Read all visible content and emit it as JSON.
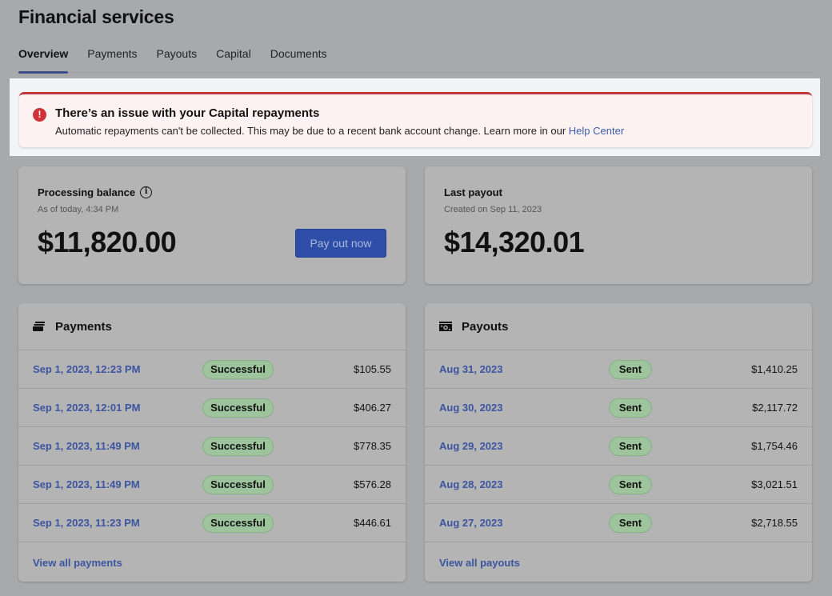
{
  "header": {
    "title": "Financial services"
  },
  "tabs": [
    {
      "label": "Overview",
      "active": true
    },
    {
      "label": "Payments",
      "active": false
    },
    {
      "label": "Payouts",
      "active": false
    },
    {
      "label": "Capital",
      "active": false
    },
    {
      "label": "Documents",
      "active": false
    }
  ],
  "alert": {
    "icon": "exclamation-circle-icon",
    "title": "There’s an issue with your Capital repayments",
    "body": "Automatic repayments can't be collected. This may be due to a recent bank account change. Learn more in our ",
    "link_label": "Help Center",
    "color": "#c0393f"
  },
  "balance": {
    "label": "Processing balance",
    "info_icon": "info-icon",
    "subtitle": "As of today, 4:34 PM",
    "amount": "$11,820.00",
    "button_label": "Pay out now"
  },
  "last_payout": {
    "label": "Last payout",
    "subtitle": "Created on Sep 11, 2023",
    "amount": "$14,320.01"
  },
  "payments": {
    "title": "Payments",
    "icon": "card-stack-icon",
    "rows": [
      {
        "date": "Sep 1, 2023, 12:23 PM",
        "status": "Successful",
        "amount": "$105.55"
      },
      {
        "date": "Sep 1, 2023, 12:01 PM",
        "status": "Successful",
        "amount": "$406.27"
      },
      {
        "date": "Sep 1, 2023, 11:49 PM",
        "status": "Successful",
        "amount": "$778.35"
      },
      {
        "date": "Sep 1, 2023, 11:49 PM",
        "status": "Successful",
        "amount": "$576.28"
      },
      {
        "date": "Sep 1, 2023, 11:23 PM",
        "status": "Successful",
        "amount": "$446.61"
      }
    ],
    "view_all_label": "View all payments"
  },
  "payouts": {
    "title": "Payouts",
    "icon": "cash-icon",
    "rows": [
      {
        "date": "Aug 31, 2023",
        "status": "Sent",
        "amount": "$1,410.25"
      },
      {
        "date": "Aug 30, 2023",
        "status": "Sent",
        "amount": "$2,117.72"
      },
      {
        "date": "Aug 29, 2023",
        "status": "Sent",
        "amount": "$1,754.46"
      },
      {
        "date": "Aug 28, 2023",
        "status": "Sent",
        "amount": "$3,021.51"
      },
      {
        "date": "Aug 27, 2023",
        "status": "Sent",
        "amount": "$2,718.55"
      }
    ],
    "view_all_label": "View all payouts"
  },
  "colors": {
    "accent": "#2f4ea8",
    "link": "#3b55a0",
    "success_badge": "#9ec49e",
    "error": "#d0323a"
  }
}
